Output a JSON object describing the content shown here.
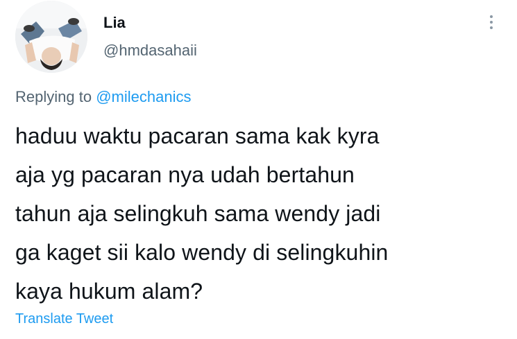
{
  "author": {
    "display_name": "Lia",
    "handle": "@hmdasahaii",
    "avatar_icon": "profile-photo"
  },
  "reply_context": {
    "prefix": "Replying to",
    "mention": "@milechanics"
  },
  "tweet": {
    "lines": [
      "haduu waktu pacaran sama kak kyra",
      "aja yg pacaran nya udah bertahun",
      "tahun aja selingkuh sama wendy jadi",
      "ga kaget sii kalo wendy di selingkuhin",
      "kaya hukum alam?"
    ]
  },
  "actions": {
    "translate_label": "Translate Tweet",
    "more_icon": "vertical-ellipsis-icon"
  },
  "colors": {
    "text_primary": "#0f1419",
    "text_secondary": "#536471",
    "link": "#1d9bf0",
    "background": "#ffffff"
  }
}
